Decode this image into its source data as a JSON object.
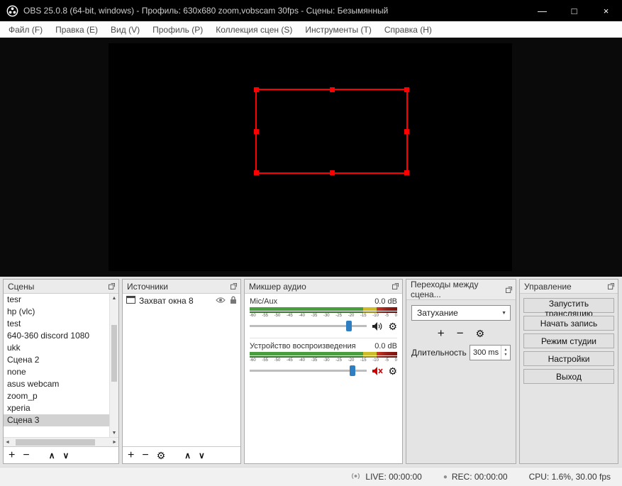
{
  "titlebar": {
    "title": "OBS 25.0.8 (64-bit, windows) - Профиль: 630x680 zoom,vobscam 30fps - Сцены: Безымянный",
    "minimize": "—",
    "maximize": "□",
    "close": "×"
  },
  "menu": {
    "items": [
      "Файл (F)",
      "Правка (E)",
      "Вид (V)",
      "Профиль (P)",
      "Коллекция сцен (S)",
      "Инструменты (T)",
      "Справка (H)"
    ]
  },
  "scenes": {
    "title": "Сцены",
    "items": [
      "tesr",
      "hp (vlc)",
      "test",
      "640-360 discord 1080",
      "ukk",
      "Сцена 2",
      "none",
      "asus webcam",
      "zoom_p",
      "xperia",
      "Сцена 3"
    ]
  },
  "sources": {
    "title": "Источники",
    "item": "Захват окна 8"
  },
  "mixer": {
    "title": "Микшер аудио",
    "channels": [
      {
        "name": "Mic/Aux",
        "db": "0.0 dB"
      },
      {
        "name": "Устройство воспроизведения",
        "db": "0.0 dB"
      }
    ],
    "scale": [
      "-60",
      "-55",
      "-50",
      "-45",
      "-40",
      "-35",
      "-30",
      "-25",
      "-20",
      "-15",
      "-10",
      "-5",
      "0"
    ]
  },
  "transitions": {
    "title": "Переходы между сцена...",
    "selected": "Затухание",
    "duration_label": "Длительность",
    "duration_value": "300 ms"
  },
  "controls": {
    "title": "Управление",
    "buttons": [
      "Запустить трансляцию",
      "Начать запись",
      "Режим студии",
      "Настройки",
      "Выход"
    ]
  },
  "statusbar": {
    "live": "LIVE: 00:00:00",
    "rec": "REC: 00:00:00",
    "cpu": "CPU: 1.6%, 30.00 fps"
  },
  "icons": {
    "add": "+",
    "remove": "−",
    "settings": "⚙",
    "move_up": "∧",
    "move_down": "∨",
    "dropdown": "▼",
    "scroll_up": "▲",
    "scroll_down": "▼",
    "scroll_left": "◄",
    "scroll_right": "►",
    "spin_up": "▲",
    "spin_down": "▼",
    "rec_dot": "●"
  },
  "colors": {
    "selection_red": "#ff0000",
    "slider_handle_blue": "#2e7fc2",
    "mute_red": "#cc0000",
    "meter_green": "#4b9e3f"
  }
}
